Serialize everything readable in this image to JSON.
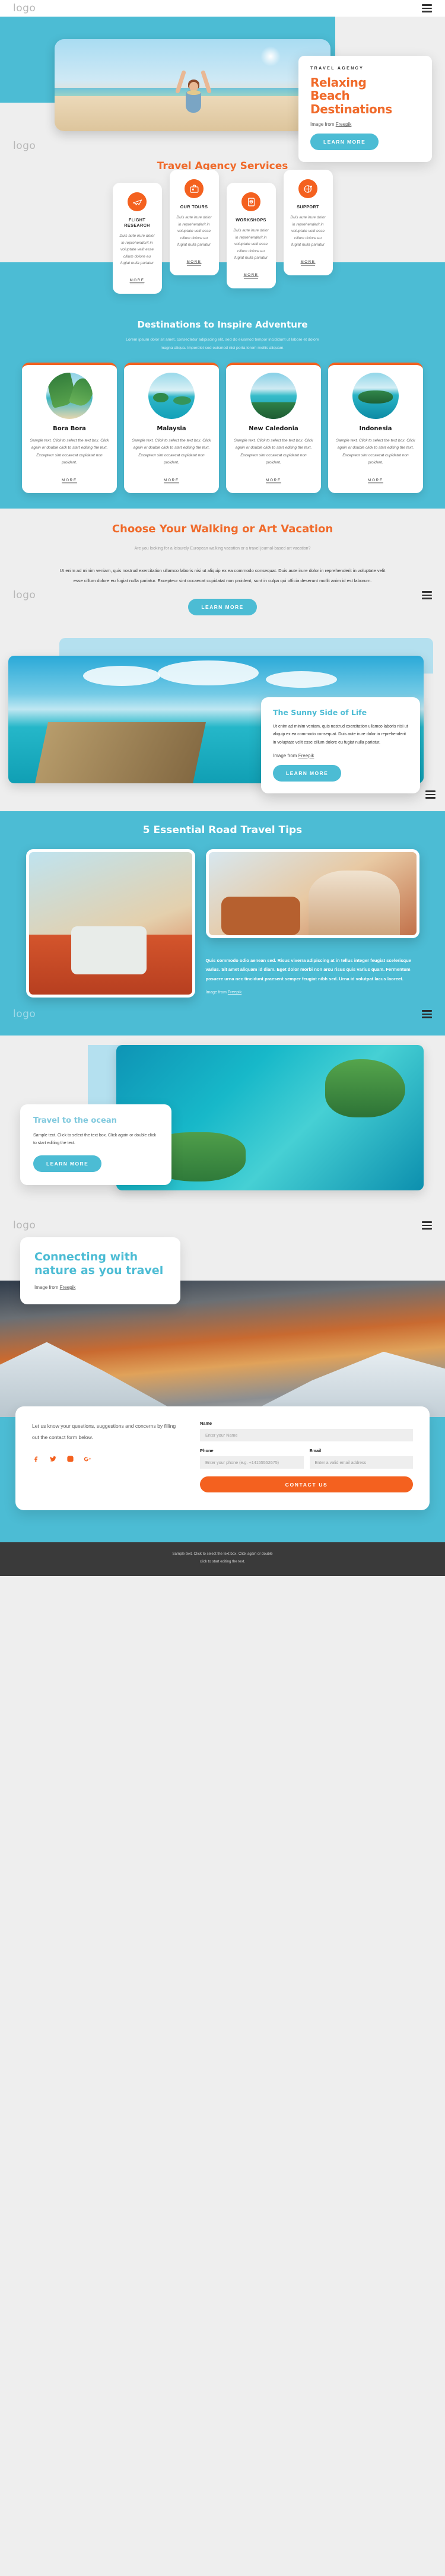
{
  "brand": {
    "logo": "logo",
    "accent_orange": "#f4611f",
    "accent_blue": "#4cbcd4"
  },
  "topbar": {
    "logo": "logo",
    "menu_icon": "hamburger-icon"
  },
  "hero": {
    "eyebrow": "TRAVEL AGENCY",
    "title_line1": "Relaxing",
    "title_line2": "Beach",
    "title_line3": "Destinations",
    "credit_prefix": "Image from ",
    "credit_link": "Freepik",
    "cta": "LEARN MORE"
  },
  "services": {
    "heading": "Travel Agency Services",
    "cards": [
      {
        "icon": "airplane-icon",
        "title": "FLIGHT RESEARCH",
        "body": "Duis aute irure dolor in reprehenderit in voluptate velit esse cillum dolore eu fugiat nulla pariatur",
        "more": "MORE"
      },
      {
        "icon": "suitcase-icon",
        "title": "OUR TOURS",
        "body": "Duis aute irure dolor in reprehenderit in voluptate velit esse cillum dolore eu fugiat nulla pariatur",
        "more": "MORE"
      },
      {
        "icon": "passport-icon",
        "title": "WORKSHOPS",
        "body": "Duis aute irure dolor in reprehenderit in voluptate velit esse cillum dolore eu fugiat nulla pariatur",
        "more": "MORE"
      },
      {
        "icon": "globe-pin-icon",
        "title": "SUPPORT",
        "body": "Duis aute irure dolor in reprehenderit in voluptate velit esse cillum dolore eu fugiat nulla pariatur",
        "more": "MORE"
      }
    ]
  },
  "destinations": {
    "heading": "Destinations to Inspire Adventure",
    "subtitle": "Lorem ipsum dolor sit amet, consectetur adipiscing elit, sed do eiusmod tempor incididunt ut labore et dolore magna aliqua. Imperdiet sed euismod nisi porta lorem mollis aliquam.",
    "cards": [
      {
        "name": "Bora Bora",
        "body": "Sample text. Click to select the text box. Click again or double click to start editing the text. Excepteur sint occaecat cupidatat non proident.",
        "more": "MORE"
      },
      {
        "name": "Malaysia",
        "body": "Sample text. Click to select the text box. Click again or double click to start editing the text. Excepteur sint occaecat cupidatat non proident.",
        "more": "MORE"
      },
      {
        "name": "New Caledonia",
        "body": "Sample text. Click to select the text box. Click again or double click to start editing the text. Excepteur sint occaecat cupidatat non proident.",
        "more": "MORE"
      },
      {
        "name": "Indonesia",
        "body": "Sample text. Click to select the text box. Click again or double click to start editing the text. Excepteur sint occaecat cupidatat non proident.",
        "more": "MORE"
      }
    ]
  },
  "walking": {
    "heading": "Choose Your Walking or Art Vacation",
    "subtitle": "Are you looking for a leisurely European walking vacation or a travel journal-based art vacation?",
    "body": "Ut enim ad minim veniam, quis nostrud exercitation ullamco laboris nisi ut aliquip ex ea commodo consequat. Duis aute irure dolor in reprehenderit in voluptate velit esse cillum dolore eu fugiat nulla pariatur. Excepteur sint occaecat cupidatat non proident, sunt in culpa qui officia deserunt mollit anim id est laborum.",
    "cta": "LEARN MORE",
    "logo": "logo",
    "menu_icon": "hamburger-icon"
  },
  "sunny": {
    "title": "The Sunny Side of Life",
    "body": "Ut enim ad minim veniam, quis nostrud exercitation ullamco laboris nisi ut aliquip ex ea commodo consequat. Duis aute irure dolor in reprehenderit in voluptate velit esse cillum dolore eu fugiat nulla pariatur.",
    "credit_prefix": "Image from ",
    "credit_link": "Freepik",
    "cta": "LEARN MORE",
    "menu_icon": "hamburger-icon"
  },
  "road": {
    "heading": "5 Essential Road Travel Tips",
    "body": "Quis commodo odio aenean sed. Risus viverra adipiscing at in tellus integer feugiat scelerisque varius. Sit amet aliquam id diam. Eget dolor morbi non arcu risus quis varius quam. Fermentum posuere urna nec tincidunt praesent semper feugiat nibh sed. Urna id volutpat lacus laoreet.",
    "credit_prefix": "Image from ",
    "credit_link": "Freepik",
    "logo": "logo",
    "menu_icon": "hamburger-icon"
  },
  "ocean": {
    "title": "Travel to the ocean",
    "body": "Sample text. Click to select the text box. Click again or double click to start editing the text.",
    "cta": "LEARN MORE",
    "logo": "logo",
    "menu_icon": "hamburger-icon"
  },
  "nature": {
    "title": "Connecting with nature as you travel",
    "credit_prefix": "Image from ",
    "credit_link": "Freepik",
    "logo": "logo",
    "menu_icon": "hamburger-icon"
  },
  "contact": {
    "lead": "Let us know your questions, suggestions and concerns by filling out the contact form below.",
    "socials": [
      {
        "icon": "facebook-icon"
      },
      {
        "icon": "twitter-icon"
      },
      {
        "icon": "instagram-icon"
      },
      {
        "icon": "google-plus-icon"
      }
    ],
    "fields": {
      "name_label": "Name",
      "name_placeholder": "Enter your Name",
      "phone_label": "Phone",
      "phone_placeholder": "Enter your phone (e.g. +14155552675)",
      "email_label": "Email",
      "email_placeholder": "Enter a valid email address"
    },
    "submit": "CONTACT US"
  },
  "footer": {
    "line1": "Sample text. Click to select the text box. Click again or double",
    "line2": "click to start editing the text."
  }
}
